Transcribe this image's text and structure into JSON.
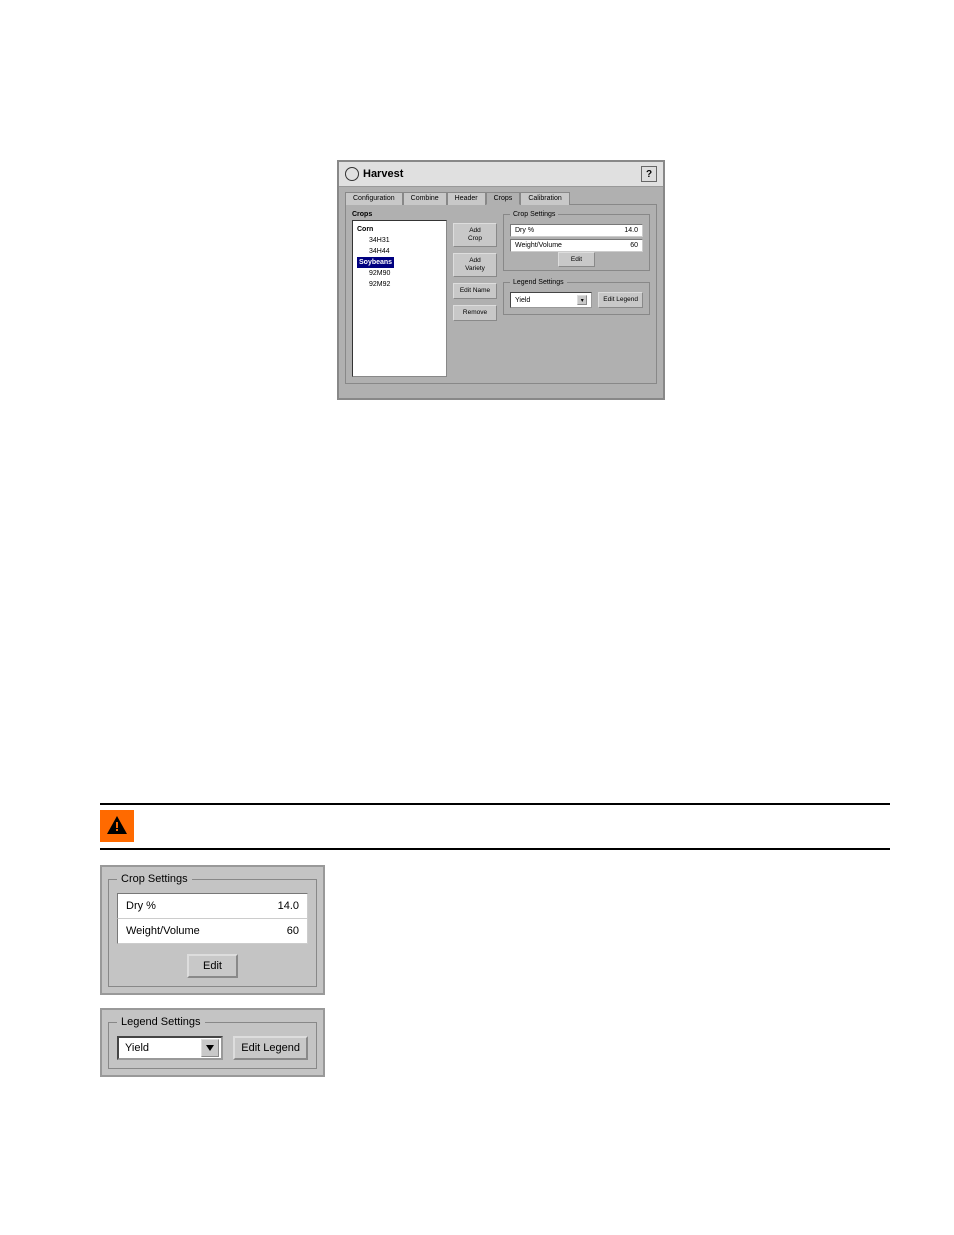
{
  "dialog": {
    "title": "Harvest",
    "help_label": "?",
    "tabs": [
      "Configuration",
      "Combine",
      "Header",
      "Crops",
      "Calibration"
    ],
    "active_tab_index": 3,
    "crops_label": "Crops",
    "tree": {
      "crop1": "Corn",
      "crop1_varieties": [
        "34H31",
        "34H44"
      ],
      "crop2": "Soybeans",
      "crop2_varieties": [
        "92M90",
        "92M92"
      ]
    },
    "buttons": {
      "add_crop": "Add\nCrop",
      "add_variety": "Add\nVariety",
      "edit_name": "Edit Name",
      "remove": "Remove"
    },
    "crop_settings": {
      "legend": "Crop Settings",
      "dry_label": "Dry %",
      "dry_value": "14.0",
      "wv_label": "Weight/Volume",
      "wv_value": "60",
      "edit": "Edit"
    },
    "legend_settings": {
      "legend": "Legend Settings",
      "selected": "Yield",
      "edit": "Edit Legend"
    }
  },
  "enlarged": {
    "crop_settings": {
      "legend": "Crop Settings",
      "dry_label": "Dry %",
      "dry_value": "14.0",
      "wv_label": "Weight/Volume",
      "wv_value": "60",
      "edit": "Edit"
    },
    "legend_settings": {
      "legend": "Legend Settings",
      "selected": "Yield",
      "edit": "Edit Legend"
    }
  }
}
